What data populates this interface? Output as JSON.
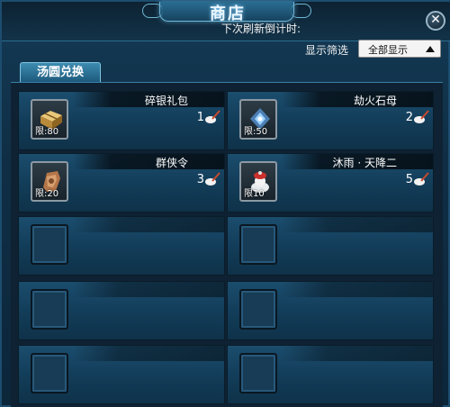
{
  "window": {
    "title": "商店"
  },
  "header": {
    "refresh_label": "下次刷新倒计时:",
    "filter_label": "显示筛选",
    "filter_value": "全部显示"
  },
  "tab": {
    "label": "汤圆兑换"
  },
  "items": [
    {
      "name": "碎银礼包",
      "limit": "限:80",
      "price": "1",
      "icon": "silver-package-icon"
    },
    {
      "name": "劫火石母",
      "limit": "限:50",
      "price": "2",
      "icon": "blue-crystal-icon"
    },
    {
      "name": "群侠令",
      "limit": "限:20",
      "price": "3",
      "icon": "bronze-token-icon"
    },
    {
      "name": "沐雨 · 天降二",
      "limit": "限10",
      "price": "5",
      "icon": "red-hat-figure-icon"
    }
  ],
  "empty_slot_count": 6
}
